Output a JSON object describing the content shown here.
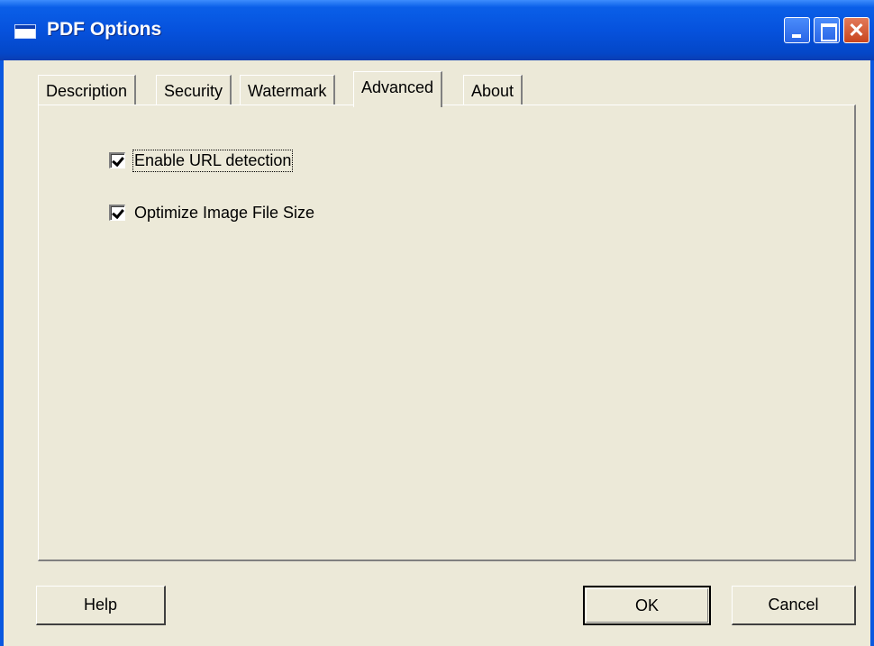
{
  "window": {
    "title": "PDF Options"
  },
  "tabs": [
    {
      "label": "Description",
      "active": false
    },
    {
      "label": "Security",
      "active": false
    },
    {
      "label": "Watermark",
      "active": false
    },
    {
      "label": "Advanced",
      "active": true
    },
    {
      "label": "About",
      "active": false
    }
  ],
  "options": {
    "enable_url_detection": {
      "label": "Enable URL detection",
      "checked": true
    },
    "optimize_image_file_size": {
      "label": "Optimize Image File Size",
      "checked": true
    }
  },
  "buttons": {
    "help": "Help",
    "ok": "OK",
    "cancel": "Cancel"
  },
  "colors": {
    "titlebar": "#0652dd",
    "dialog_face": "#ece9d8",
    "close_button": "#c8451e"
  }
}
